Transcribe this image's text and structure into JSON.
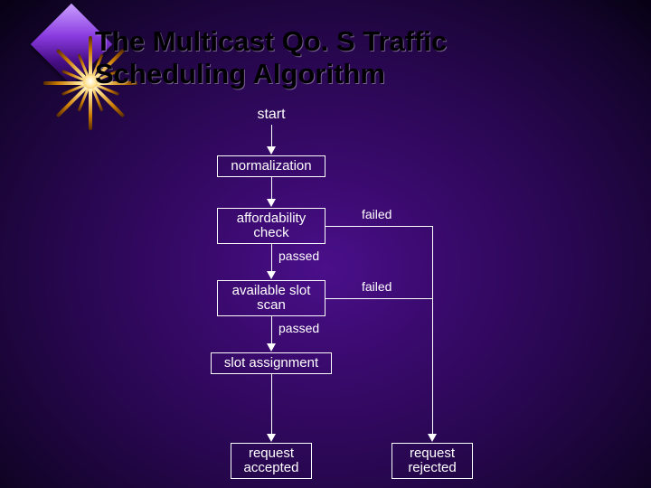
{
  "title_line1": "The Multicast Qo. S Traffic",
  "title_line2": "Scheduling Algorithm",
  "nodes": {
    "start": {
      "label": "start"
    },
    "normalization": {
      "label": "normalization"
    },
    "affordability": {
      "label": "affordability\ncheck"
    },
    "slotscan": {
      "label": "available slot\nscan"
    },
    "assignment": {
      "label": "slot assignment"
    },
    "accepted": {
      "label": "request\naccepted"
    },
    "rejected": {
      "label": "request\nrejected"
    }
  },
  "edges": {
    "aff_passed": {
      "label": "passed"
    },
    "aff_failed": {
      "label": "failed"
    },
    "scan_passed": {
      "label": "passed"
    },
    "scan_failed": {
      "label": "failed"
    }
  }
}
